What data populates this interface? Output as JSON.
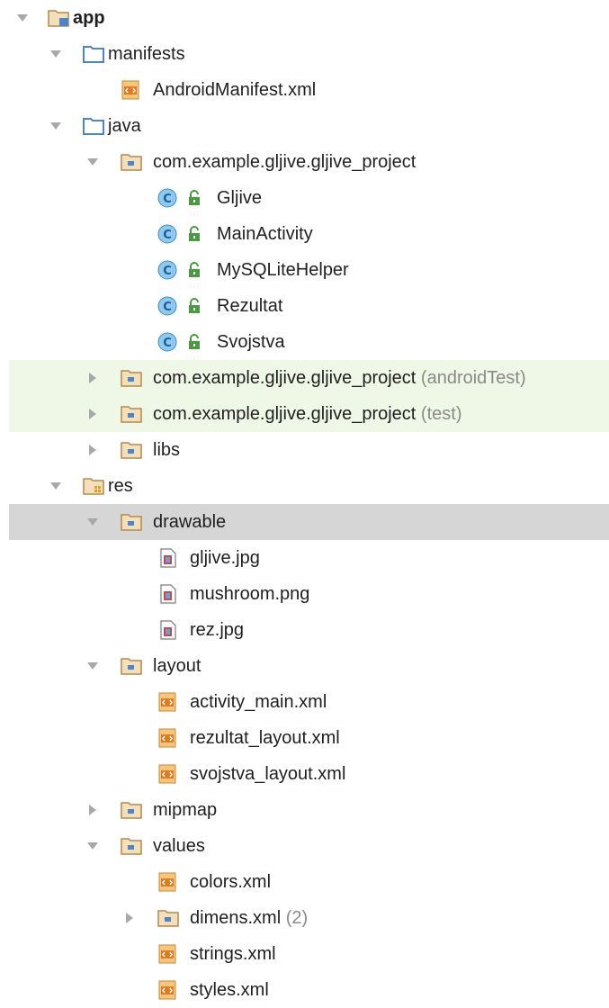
{
  "colors": {
    "folder": "#b58a4a",
    "folder_blue": "#4c86c8",
    "xml_orange": "#e08a2c",
    "class_blue": "#52a6d9",
    "lock_green": "#4b9a43",
    "highlight_green": "#eff7e7",
    "highlight_gray": "#d6d6d6"
  },
  "tree": {
    "app": "app",
    "manifests": "manifests",
    "android_manifest": "AndroidManifest.xml",
    "java": "java",
    "pkg_main": "com.example.gljive.gljive_project",
    "cls_gljive": "Gljive",
    "cls_main_activity": "MainActivity",
    "cls_sqlite": "MySQLiteHelper",
    "cls_rezultat": "Rezultat",
    "cls_svojstva": "Svojstva",
    "pkg_android_test": "com.example.gljive.gljive_project",
    "pkg_android_test_suffix": "(androidTest)",
    "pkg_test": "com.example.gljive.gljive_project",
    "pkg_test_suffix": "(test)",
    "libs": "libs",
    "res": "res",
    "drawable": "drawable",
    "gljive_jpg": "gljive.jpg",
    "mushroom_png": "mushroom.png",
    "rez_jpg": "rez.jpg",
    "layout": "layout",
    "activity_main": "activity_main.xml",
    "rezultat_layout": "rezultat_layout.xml",
    "svojstva_layout": "svojstva_layout.xml",
    "mipmap": "mipmap",
    "values": "values",
    "colors_xml": "colors.xml",
    "dimens_xml": "dimens.xml",
    "dimens_count": "(2)",
    "strings_xml": "strings.xml",
    "styles_xml": "styles.xml"
  }
}
